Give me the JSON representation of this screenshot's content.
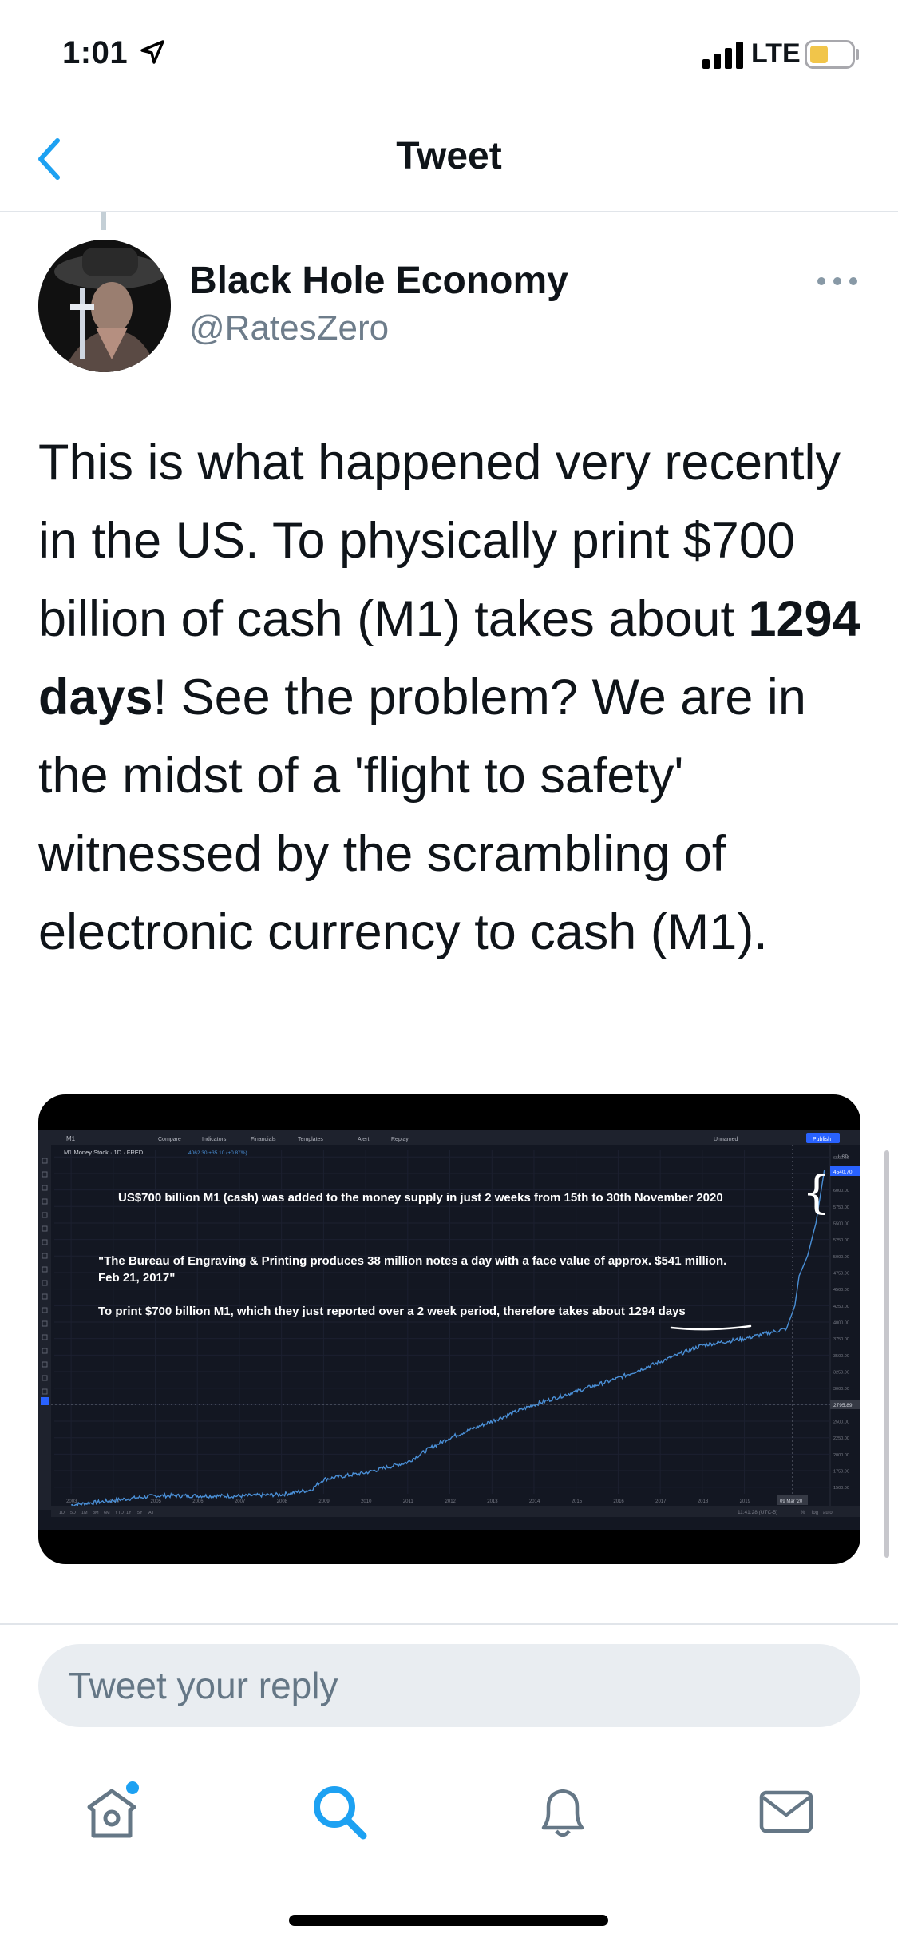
{
  "status_bar": {
    "time": "1:01",
    "network": "LTE"
  },
  "nav": {
    "title": "Tweet",
    "back_icon": "chevron-left-icon"
  },
  "tweet": {
    "author_name": "Black Hole Economy",
    "author_handle": "@RatesZero",
    "text_before": "This is what happened very recently in the US. To physically print $700 billion of cash (M1) takes about ",
    "text_bold": "1294 days",
    "text_after": "! See the problem? We are in the midst of a 'flight to safety' witnessed by the scrambling of electronic currency to cash (M1)."
  },
  "media": {
    "toolbar": {
      "symbol": "M1",
      "compare": "Compare",
      "indicators": "Indicators",
      "financials": "Financials",
      "templates": "Templates",
      "alert": "Alert",
      "replay": "Replay",
      "unnamed": "Unnamed",
      "publish": "Publish"
    },
    "legend": {
      "title": "M1 Money Stock · 1D · FRED",
      "value": "4062.30 +35.10 (+0.87%)"
    },
    "annotations": {
      "line1": "US$700 billion M1 (cash) was added to the money supply in just 2 weeks from 15th to 30th  November 2020",
      "quote_line1": "\"The Bureau of Engraving & Printing produces 38 million notes a day with a face value of approx. $541 million.",
      "quote_line2": "Feb 21, 2017\"",
      "line3": "To print $700 billion M1, which they just reported over a 2 week period, therefore takes about 1294 days"
    },
    "price_scale": {
      "currency": "USD",
      "current": "4540.70",
      "marker": "2795.89"
    },
    "timeframes": [
      "1D",
      "5D",
      "1M",
      "3M",
      "6M",
      "YTD",
      "1Y",
      "5Y",
      "All"
    ],
    "footer_time": "11:41:28 (UTC-5)",
    "footer_opts": [
      "%",
      "log",
      "auto"
    ],
    "date_marker": "09 Mar '20",
    "chart_data": {
      "type": "line",
      "title": "M1 Money Stock · 1D · FRED",
      "xlabel": "",
      "ylabel": "",
      "x_ticks": [
        "2003",
        "2004",
        "2005",
        "2006",
        "2007",
        "2008",
        "2009",
        "2010",
        "2011",
        "2012",
        "2013",
        "2014",
        "2015",
        "2016",
        "2017",
        "2018",
        "2019"
      ],
      "y_ticks": [
        "6500.00",
        "6250.00",
        "6000.00",
        "5750.00",
        "5500.00",
        "5250.00",
        "5000.00",
        "4750.00",
        "4500.00",
        "4250.00",
        "4000.00",
        "3750.00",
        "3500.00",
        "3250.00",
        "3000.00",
        "2750.00",
        "2500.00",
        "2250.00",
        "2000.00",
        "1750.00",
        "1500.00"
      ],
      "ylim": [
        1400,
        6600
      ],
      "x": [
        2003.0,
        2004.0,
        2005.0,
        2006.0,
        2007.0,
        2008.0,
        2008.7,
        2009.0,
        2010.0,
        2011.0,
        2011.5,
        2012.0,
        2013.0,
        2014.0,
        2015.0,
        2016.0,
        2017.0,
        2018.0,
        2019.0,
        2020.0,
        2020.2,
        2020.3,
        2020.5,
        2020.7,
        2020.9
      ],
      "values": [
        1230,
        1300,
        1370,
        1370,
        1365,
        1390,
        1460,
        1620,
        1720,
        1880,
        2080,
        2250,
        2500,
        2750,
        2950,
        3150,
        3400,
        3650,
        3750,
        3900,
        4250,
        4700,
        5000,
        5500,
        6300
      ],
      "grid": true
    }
  },
  "reply": {
    "placeholder": "Tweet your reply"
  },
  "tabs": {
    "home": "home-icon",
    "search": "search-icon",
    "notifications": "bell-icon",
    "messages": "mail-icon"
  },
  "colors": {
    "accent": "#1da1f2",
    "chart_bg": "#131722",
    "chart_line": "#4a8fd6"
  }
}
